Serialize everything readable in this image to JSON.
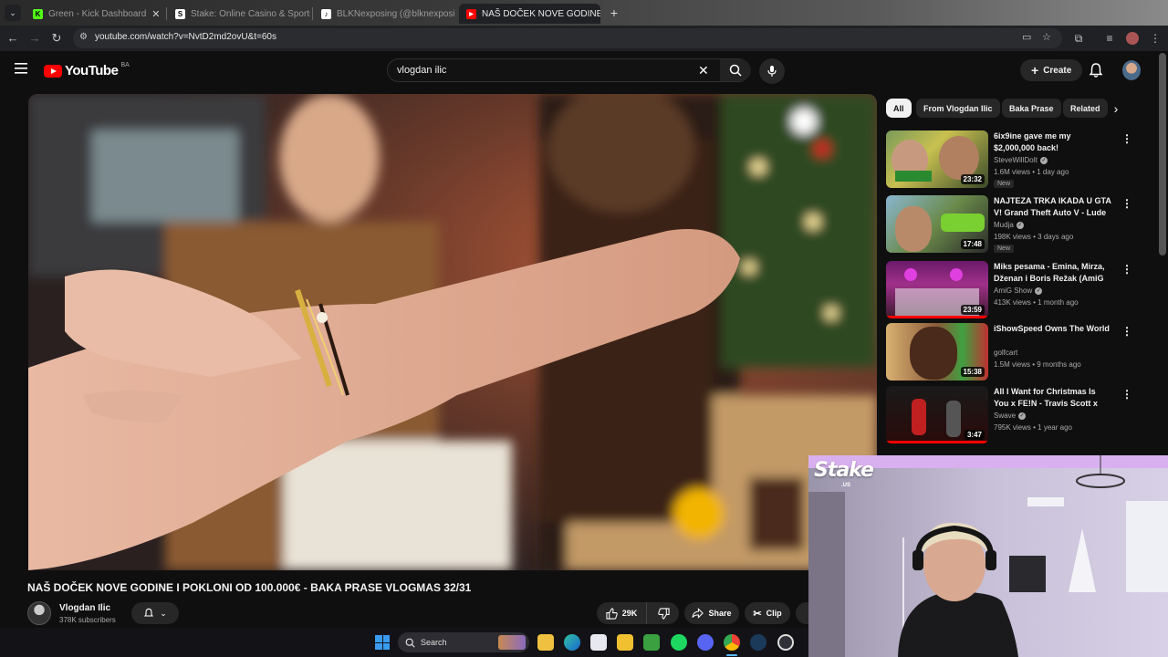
{
  "browser": {
    "tabs": [
      {
        "label": "Green - Kick Dashboard",
        "fav_color": "#53fc18",
        "fav_text": "K"
      },
      {
        "label": "Stake: Online Casino & Sports",
        "fav_color": "#ffffff",
        "fav_text": "S"
      },
      {
        "label": "BLKNexposing (@blknexposing)",
        "fav_color": "#ffffff",
        "fav_text": "♪"
      },
      {
        "label": "NAŠ DOČEK NOVE GODINE I P",
        "fav_color": "#ff0000",
        "fav_text": "▶"
      }
    ],
    "url": "youtube.com/watch?v=NvtD2md2ovU&t=60s"
  },
  "youtube": {
    "logo_word": "YouTube",
    "country_code": "BA",
    "search_query": "vlogdan ilic",
    "create_label": "Create"
  },
  "video": {
    "title": "NAŠ DOČEK NOVE GODINE I POKLONI OD 100.000€ - BAKA PRASE VLOGMAS 32/31",
    "channel": "Vlogdan Ilic",
    "subscribers": "378K subscribers",
    "likes": "29K",
    "share_label": "Share",
    "clip_label": "Clip"
  },
  "sidebar": {
    "chips": [
      "All",
      "From Vlogdan Ilic",
      "Baka Prase",
      "Related"
    ],
    "recommendations": [
      {
        "title": "6ix9ine gave me my $2,000,000 back!",
        "channel": "SteveWillDoIt",
        "meta": "1.6M views • 1 day ago",
        "badge": "New",
        "duration": "23:32"
      },
      {
        "title": "NAJTEZA TRKA IKADA U GTA V! Grand Theft Auto V - Lude ...",
        "channel": "Mudja",
        "meta": "198K views • 3 days ago",
        "badge": "New",
        "duration": "17:48"
      },
      {
        "title": "Miks pesama - Emina, Mirza, Dženan i Boris Režak (AmiG ...",
        "channel": "AmiG Show",
        "meta": "413K views • 1 month ago",
        "badge": "",
        "duration": "23:59"
      },
      {
        "title": "iShowSpeed Owns The World",
        "channel": "golfcart",
        "meta": "1.5M views • 9 months ago",
        "badge": "",
        "duration": "15:38"
      },
      {
        "title": "All I Want for Christmas Is You x FE!N - Travis Scott x Mariah ...",
        "channel": "Swave",
        "meta": "795K views • 1 year ago",
        "badge": "",
        "duration": "3:47"
      }
    ]
  },
  "overlay": {
    "brand": "Stake",
    "brand_sub": ".US"
  },
  "taskbar": {
    "search_label": "Search"
  },
  "colors": {
    "accent_red": "#ff0000",
    "background": "#0f0f0f",
    "chip_bg": "#272727"
  }
}
